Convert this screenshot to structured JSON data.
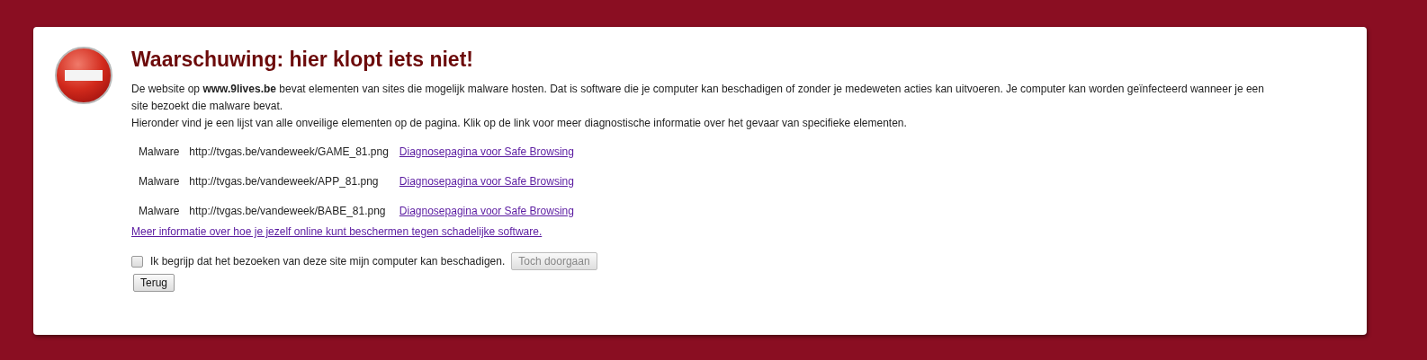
{
  "title": "Waarschuwing: hier klopt iets niet!",
  "paragraphs": [
    "De website op **www.9lives.be** bevat elementen van sites die mogelijk malware hosten. Dat is software die je computer kan beschadigen of zonder je medeweten acties kan uitvoeren. Je computer kan worden geïnfecteerd wanneer je een site bezoekt die malware bevat.",
    "Hieronder vind je een lijst van alle onveilige elementen op de pagina. Klik op de link voor meer diagnostische informatie over het gevaar van specifieke elementen."
  ],
  "elements": [
    {
      "type": "Malware",
      "url": "http://tvgas.be/vandeweek/GAME_81.png",
      "link": "Diagnosepagina voor Safe Browsing"
    },
    {
      "type": "Malware",
      "url": "http://tvgas.be/vandeweek/APP_81.png",
      "link": "Diagnosepagina voor Safe Browsing"
    },
    {
      "type": "Malware",
      "url": "http://tvgas.be/vandeweek/BABE_81.png",
      "link": "Diagnosepagina voor Safe Browsing"
    }
  ],
  "more_info_link": "Meer informatie over hoe je jezelf online kunt beschermen tegen schadelijke software.",
  "consent": {
    "label": "Ik begrijp dat het bezoeken van deze site mijn computer kan beschadigen.",
    "checked": false
  },
  "continue_button": {
    "label": "Toch doorgaan",
    "disabled": true
  },
  "back_button": {
    "label": "Terug"
  }
}
